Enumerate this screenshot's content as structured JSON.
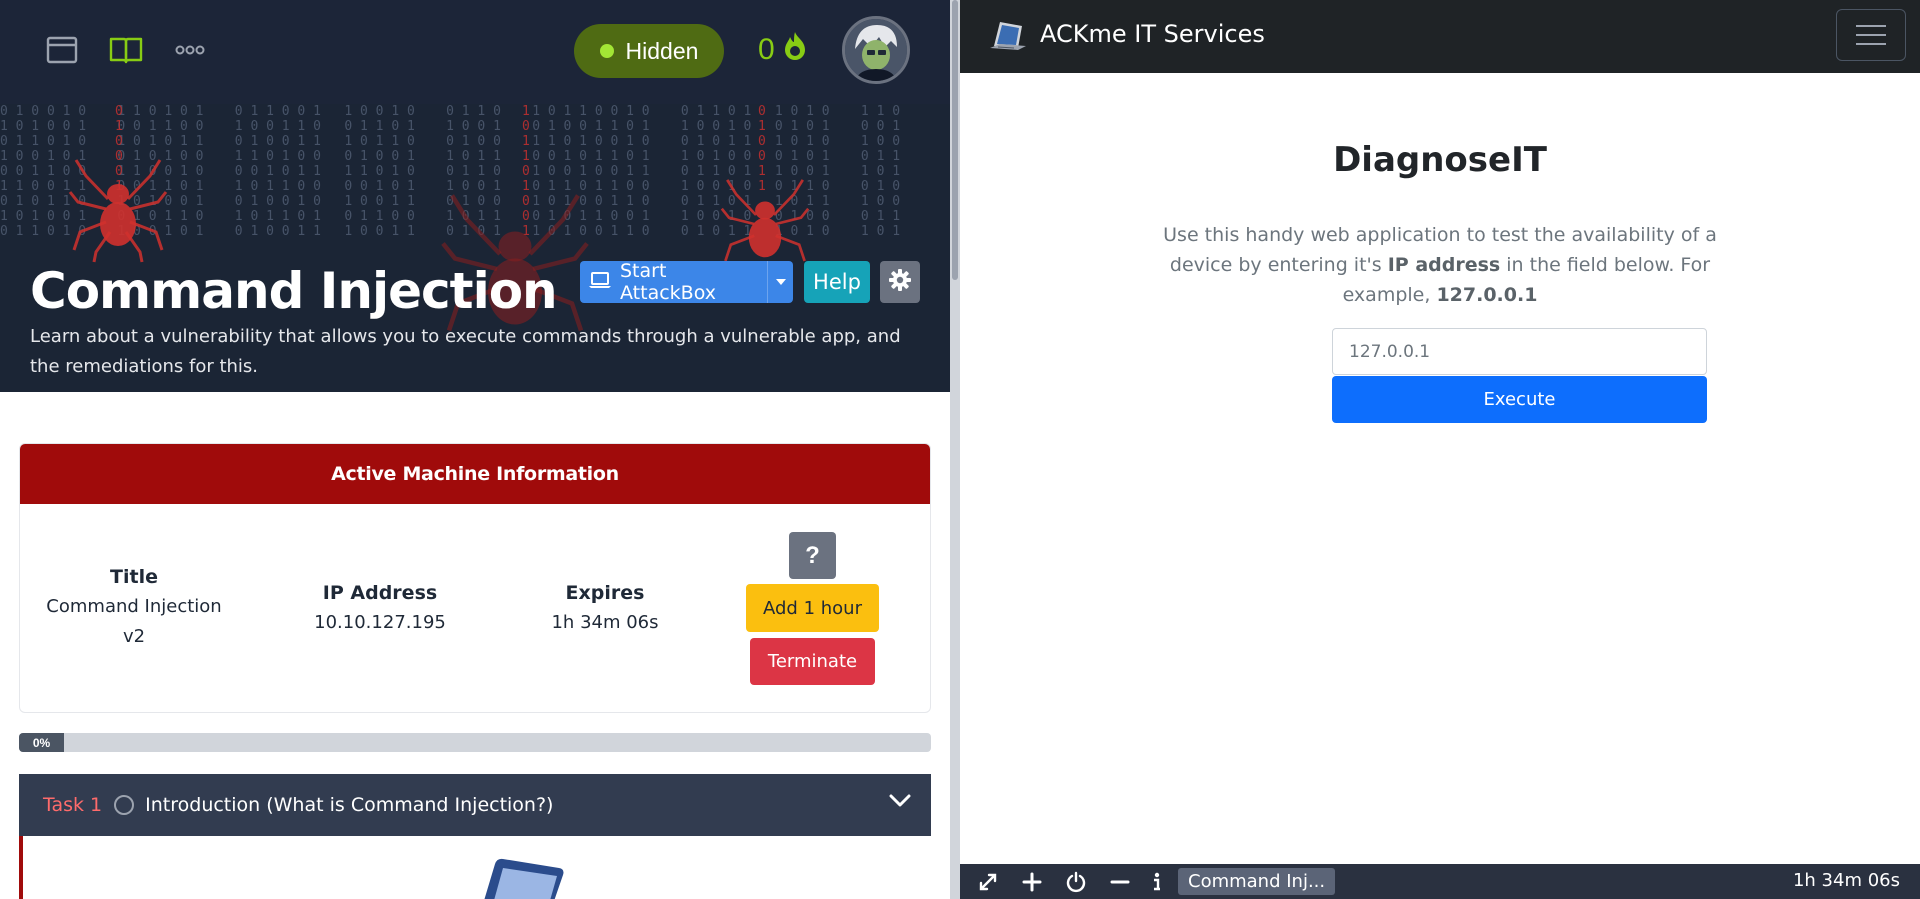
{
  "topnav": {
    "status_label": "Hidden",
    "streak_count": "0",
    "icons": [
      "window-icon",
      "book-icon",
      "more-icon",
      "fire-icon"
    ]
  },
  "room": {
    "title": "Command Injection",
    "description": "Learn about a vulnerability that allows you to execute commands through a vulnerable app, and the remediations for this.",
    "attackbox_label": "Start AttackBox",
    "help_label": "Help"
  },
  "machine": {
    "header": "Active Machine Information",
    "title_label": "Title",
    "title_value_line1": "Command Injection",
    "title_value_line2": "v2",
    "ip_label": "IP Address",
    "ip_value": "10.10.127.195",
    "expires_label": "Expires",
    "expires_value": "1h 34m 06s",
    "help_glyph": "?",
    "add_hour_label": "Add 1 hour",
    "terminate_label": "Terminate"
  },
  "progress": {
    "label": "0%",
    "value": 0
  },
  "task": {
    "number": "Task 1",
    "title": "Introduction (What is Command Injection?)"
  },
  "ackme": {
    "brand": "ACKme IT Services",
    "heading": "DiagnoseIT",
    "desc_part1": "Use this handy web application to test the availability of a device by entering it's ",
    "desc_bold1": "IP address",
    "desc_part2": " in the field below. For example, ",
    "desc_bold2": "127.0.0.1",
    "input_placeholder": "127.0.0.1",
    "execute_label": "Execute"
  },
  "vmbar": {
    "tab_label": "Command Inj...",
    "timer": "1h 34m 06s",
    "icons": [
      "fullscreen-icon",
      "plus-icon",
      "power-icon",
      "minus-icon",
      "info-icon"
    ]
  },
  "colors": {
    "nav_bg": "#1c2538",
    "accent_green": "#88cc14",
    "card_header": "#a00b0b",
    "primary_blue": "#0d6efd",
    "danger": "#dc3545",
    "warning": "#fbbf0f"
  }
}
